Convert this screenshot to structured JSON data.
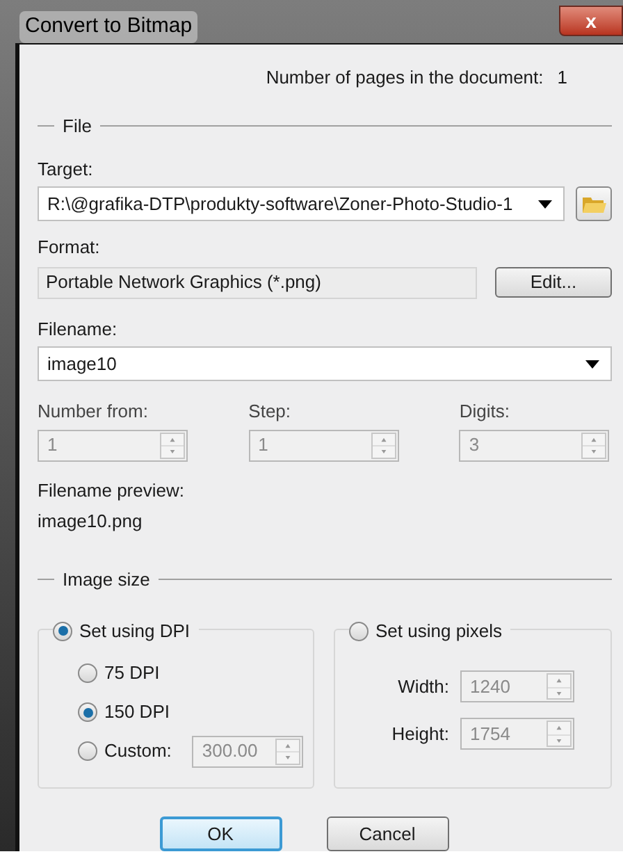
{
  "window": {
    "title": "Convert to Bitmap",
    "close": "x"
  },
  "page_count": {
    "label": "Number of pages in the document:",
    "value": "1"
  },
  "file": {
    "legend": "File",
    "target": {
      "label": "Target:",
      "value": "R:\\@grafika-DTP\\produkty-software\\Zoner-Photo-Studio-1"
    },
    "format": {
      "label": "Format:",
      "value": "Portable Network Graphics (*.png)",
      "edit": "Edit..."
    },
    "filename": {
      "label": "Filename:",
      "value": "image10"
    },
    "numbering": [
      {
        "label": "Number from:",
        "value": "1",
        "disabled": true
      },
      {
        "label": "Step:",
        "value": "1",
        "disabled": true
      },
      {
        "label": "Digits:",
        "value": "3",
        "disabled": true
      }
    ],
    "preview": {
      "label": "Filename preview:",
      "value": "image10.png"
    }
  },
  "image_size": {
    "legend": "Image size",
    "dpi_group": {
      "label": "Set using DPI",
      "selected": true,
      "options": [
        {
          "label": "75 DPI",
          "selected": false
        },
        {
          "label": "150 DPI",
          "selected": true
        },
        {
          "label": "Custom:",
          "selected": false,
          "value": "300.00",
          "disabled": true
        }
      ]
    },
    "pixels_group": {
      "label": "Set using pixels",
      "selected": false,
      "fields": [
        {
          "label": "Width:",
          "value": "1240",
          "disabled": true
        },
        {
          "label": "Height:",
          "value": "1754",
          "disabled": true
        }
      ]
    }
  },
  "buttons": [
    {
      "label": "OK",
      "default": true
    },
    {
      "label": "Cancel",
      "default": false
    }
  ]
}
